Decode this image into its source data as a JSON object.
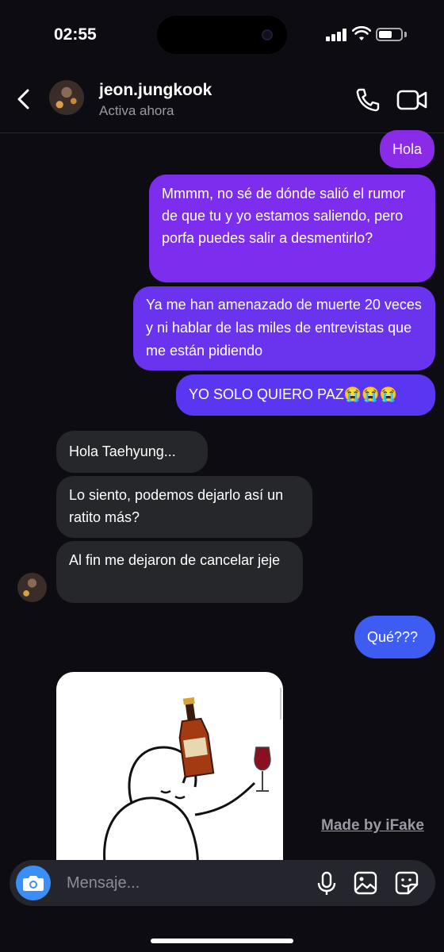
{
  "status_bar": {
    "time": "02:55",
    "battery_level": 0.6
  },
  "header": {
    "username": "jeon.jungkook",
    "presence": "Activa ahora",
    "icons": [
      "back-icon",
      "phone-icon",
      "video-camera-icon"
    ]
  },
  "messages": [
    {
      "side": "sent",
      "text": "Hola"
    },
    {
      "side": "sent",
      "text": "Mmmm, no sé de dónde salió el rumor de que tu y yo estamos saliendo, pero porfa puedes salir a desmentirlo?"
    },
    {
      "side": "sent",
      "text": "Ya me han amenazado de muerte 20 veces y ni hablar de las miles de entrevistas que me están pidiendo"
    },
    {
      "side": "sent",
      "text": "YO SOLO QUIERO PAZ😭😭😭"
    },
    {
      "side": "received",
      "text": "Hola Taehyung..."
    },
    {
      "side": "received",
      "text": "Lo siento, podemos dejarlo así un ratito más?"
    },
    {
      "side": "received",
      "text": "Al fin me dejaron de cancelar jeje"
    },
    {
      "side": "sent",
      "text": "Qué???"
    },
    {
      "side": "received",
      "type": "image",
      "description_icon": "sticker-drinking-character"
    }
  ],
  "watermark": "Made by iFake",
  "composer": {
    "placeholder": "Mensaje...",
    "icons": [
      "camera-icon",
      "microphone-icon",
      "gallery-icon",
      "sticker-icon"
    ]
  },
  "colors": {
    "background": "#0c0c12",
    "received_bubble": "#26272b",
    "sent_top": "#8a2be8",
    "sent_bottom": "#3e5bf2",
    "camera_button": "#3b8ef7"
  }
}
